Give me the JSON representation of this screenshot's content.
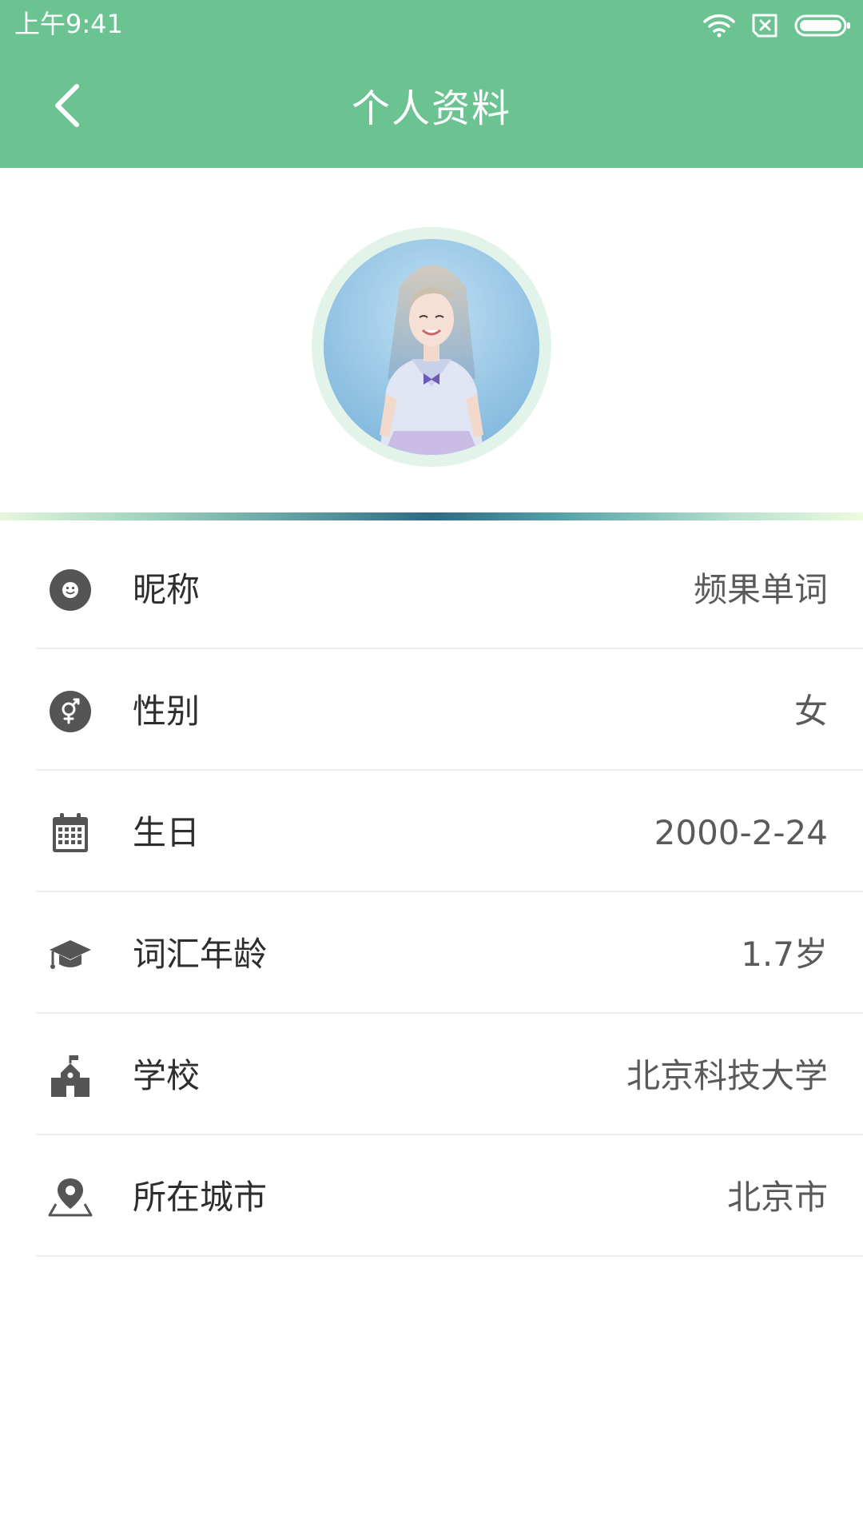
{
  "status_bar": {
    "time": "上午9:41",
    "icons": [
      "wifi-icon",
      "no-sim-icon",
      "battery-icon"
    ]
  },
  "header": {
    "title": "个人资料",
    "back_icon": "chevron-left-icon",
    "background_color": "#6cc392"
  },
  "profile": {
    "avatar": "avatar-photo"
  },
  "rows": [
    {
      "icon": "smiley-icon",
      "label": "昵称",
      "value": "频果单词"
    },
    {
      "icon": "gender-icon",
      "label": "性别",
      "value": "女"
    },
    {
      "icon": "calendar-icon",
      "label": "生日",
      "value": "2000-2-24"
    },
    {
      "icon": "graduation-cap-icon",
      "label": "词汇年龄",
      "value": "1.7岁"
    },
    {
      "icon": "school-icon",
      "label": "学校",
      "value": "北京科技大学"
    },
    {
      "icon": "location-pin-icon",
      "label": "所在城市",
      "value": "北京市"
    }
  ],
  "colors": {
    "accent": "#6cc392",
    "icon": "#555555",
    "label": "#2e2e2e",
    "value": "#5a5a5a"
  }
}
